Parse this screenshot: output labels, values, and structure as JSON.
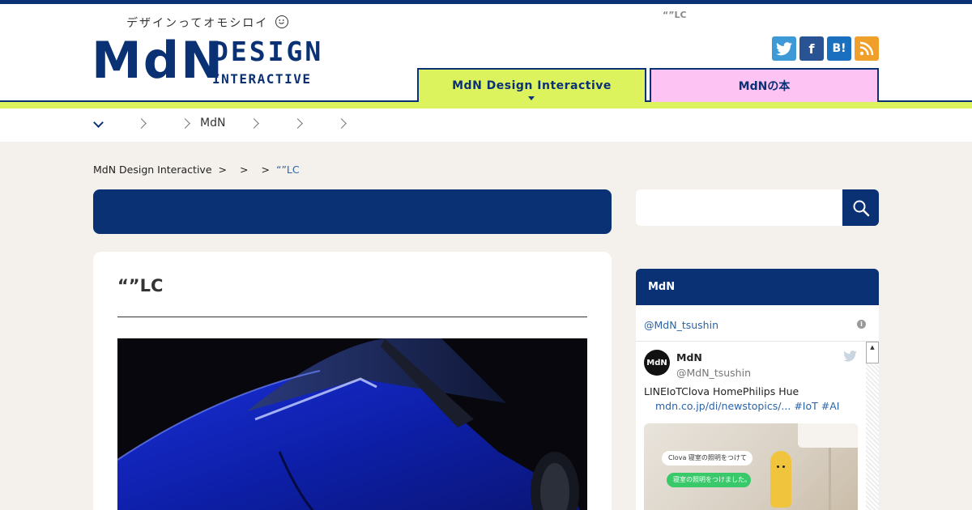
{
  "header": {
    "tagline": "デザインってオモシロイ",
    "logo_mdn": "MdN",
    "logo_design": "DESIGN",
    "logo_interactive": "INTERACTIVE",
    "top_title": "“”LC",
    "link1": "　　　　",
    "link2": "　　　　",
    "social": {
      "twitter": "t",
      "facebook": "f",
      "hatena": "B!",
      "rss": "rss"
    }
  },
  "tabs": [
    {
      "label": "MdN Design Interactive",
      "color": "#ddf35e",
      "active": true
    },
    {
      "label": "MdNの本",
      "color": "#fdc4f3",
      "active": false
    }
  ],
  "subnav": {
    "items": [
      "",
      "",
      "MdN",
      "",
      ""
    ]
  },
  "breadcrumb": {
    "root": "MdN Design Interactive",
    "sep": ">",
    "current": "“”LC"
  },
  "article": {
    "title": "“”LC"
  },
  "sidebar": {
    "widget_title": "MdN",
    "twitter_handle_link": "@MdN_tsushin",
    "tweet": {
      "name": "MdN",
      "handle": "@MdN_tsushin",
      "text": "LINEIoTClova HomePhilips Hue",
      "link_text": "mdn.co.jp/di/newstopics/... #IoT #AI",
      "image_bubble_1": "Clova 寝室の照明をつけて",
      "image_bubble_2": "寝室の照明をつけました。",
      "avatar_text": "MdN"
    }
  },
  "colors": {
    "brand_navy": "#0b3175",
    "lime": "#ddf35e",
    "pink": "#fdc4f3",
    "link_blue": "#2b63a8",
    "page_bg": "#f4f1ec"
  }
}
